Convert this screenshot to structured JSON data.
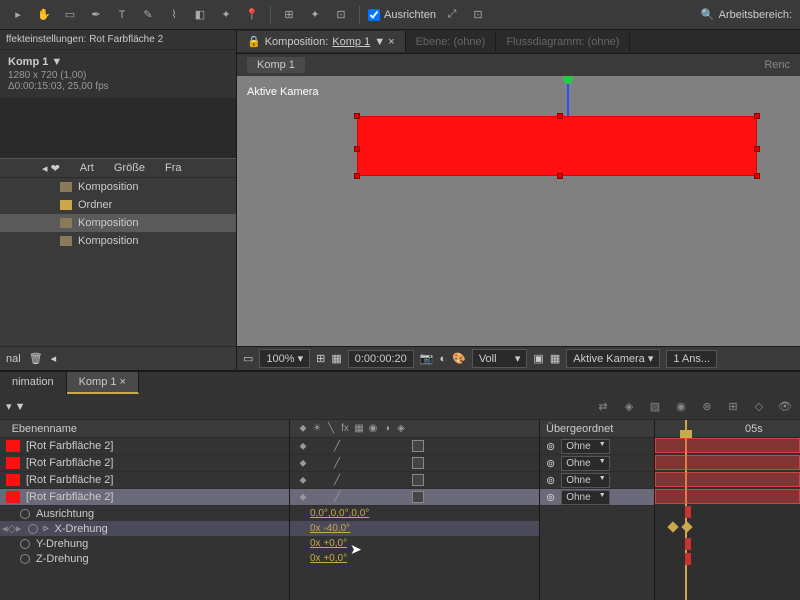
{
  "toolbar": {
    "align_label": "Ausrichten",
    "workspace_label": "Arbeitsbereich:"
  },
  "effects": {
    "header": "ffekteinstellungen: Rot Farbfläche 2"
  },
  "comp": {
    "name": "Komp 1 ▼",
    "dims": "1280 x 720 (1,00)",
    "duration": "Δ0:00:15:03, 25,00 fps"
  },
  "project": {
    "col_type": "Art",
    "col_size": "Größe",
    "col_fr": "Fra",
    "items": [
      {
        "label": "Komposition",
        "kind": "comp"
      },
      {
        "label": "Ordner",
        "kind": "folder"
      },
      {
        "label": "Komposition",
        "kind": "comp",
        "sel": true
      },
      {
        "label": "Komposition",
        "kind": "comp"
      }
    ],
    "bottom_left": "nal"
  },
  "viewer": {
    "tab_comp_prefix": "Komposition:",
    "tab_comp_name": "Komp 1",
    "tab_layer": "Ebene: (ohne)",
    "tab_flow": "Flussdiagramm: (ohne)",
    "subtab": "Komp 1",
    "renderer": "Renc",
    "camera_label": "Aktive Kamera",
    "zoom": "100%",
    "timecode": "0:00:00:20",
    "res": "Voll",
    "camera_menu": "Aktive Kamera",
    "views": "1 Ans..."
  },
  "timeline": {
    "tab_anim": "nimation",
    "tab_comp": "Komp 1",
    "header_name": "Ebenenname",
    "header_parent": "Übergeordnet",
    "parent_none": "Ohne",
    "layers": [
      {
        "name": "[Rot Farbfläche 2]"
      },
      {
        "name": "[Rot Farbfläche 2]"
      },
      {
        "name": "[Rot Farbfläche 2]"
      },
      {
        "name": "[Rot Farbfläche 2]",
        "selected": true
      }
    ],
    "props": {
      "orientation": {
        "label": "Ausrichtung",
        "value": "0,0°,0,0°,0,0°"
      },
      "xrot": {
        "label": "X-Drehung",
        "value": "0x -40,0°"
      },
      "yrot": {
        "label": "Y-Drehung",
        "value": "0x +0,0°"
      },
      "zrot": {
        "label": "Z-Drehung",
        "value": "0x +0,0°"
      }
    },
    "ruler_05s": "05s"
  }
}
